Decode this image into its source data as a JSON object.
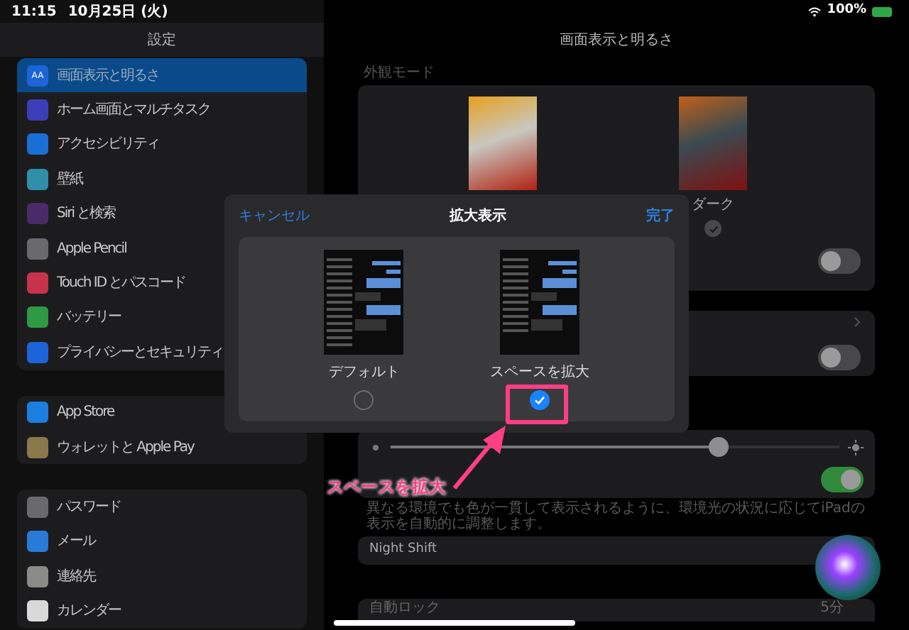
{
  "status_bar": {
    "time": "11:15",
    "date": "10月25日 (火)",
    "battery": "100%"
  },
  "sidebar": {
    "title": "設定",
    "groups": [
      {
        "items": [
          {
            "label": "画面表示と明るさ",
            "icon_text": "AA",
            "color": "#1c64d8",
            "selected": true
          },
          {
            "label": "ホーム画面とマルチタスク",
            "color": "#3a3fb8",
            "selected": false
          },
          {
            "label": "アクセシビリティ",
            "color": "#1a6fd6",
            "selected": false
          },
          {
            "label": "壁紙",
            "color": "#2f8fa8",
            "selected": false
          },
          {
            "label": "Siri と検索",
            "color": "#4b2a6a",
            "selected": false
          },
          {
            "label": "Apple Pencil",
            "color": "#6a6a6e",
            "selected": false
          },
          {
            "label": "Touch ID とパスコード",
            "color": "#c8324a",
            "selected": false
          },
          {
            "label": "バッテリー",
            "color": "#2e9a44",
            "selected": false
          },
          {
            "label": "プライバシーとセキュリティ",
            "color": "#1c64d8",
            "selected": false
          }
        ]
      },
      {
        "items": [
          {
            "label": "App Store",
            "color": "#1a7fe0",
            "selected": false
          },
          {
            "label": "ウォレットと Apple Pay",
            "color": "#8a7a4a",
            "selected": false
          }
        ]
      },
      {
        "items": [
          {
            "label": "パスワード",
            "color": "#6a6a6e",
            "selected": false
          },
          {
            "label": "メール",
            "color": "#2a7ad8",
            "selected": false
          },
          {
            "label": "連絡先",
            "color": "#8a8a86",
            "selected": false
          },
          {
            "label": "カレンダー",
            "color": "#d9d9d9",
            "selected": false
          }
        ]
      }
    ]
  },
  "detail": {
    "title": "画面表示と明るさ",
    "appearance_header": "外観モード",
    "appearance": [
      {
        "kind": "light"
      },
      {
        "kind": "dark",
        "label": "ダーク",
        "selected": true
      }
    ],
    "automatic": {
      "on": false
    },
    "row_toggle": {
      "on": false
    },
    "brightness": {
      "level": 0.73
    },
    "true_tone": {
      "on": true
    },
    "description": "異なる環境でも色が一貫して表示されるように、環境光の状況に応じてiPadの表示を自動的に調整します。",
    "night_shift": "Night Shift",
    "auto_lock": {
      "label": "自動ロック",
      "value": "5分"
    }
  },
  "modal": {
    "cancel": "キャンセル",
    "title": "拡大表示",
    "done": "完了",
    "options": [
      {
        "label": "デフォルト",
        "selected": false
      },
      {
        "label": "スペースを拡大",
        "selected": true
      }
    ]
  },
  "annotation": {
    "label": "スペースを拡大"
  }
}
